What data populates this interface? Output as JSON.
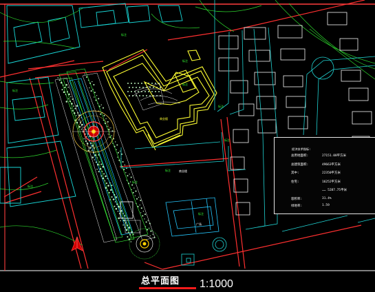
{
  "drawing": {
    "title": "总平面图",
    "scale": "1:1000"
  },
  "info_panel": {
    "heading": "经济技术指标:",
    "rows": [
      {
        "label": "总用地面积:",
        "value": "27151.08平方米"
      },
      {
        "label": "总建筑面积:",
        "value": "49663平方米"
      },
      {
        "label": "其中:",
        "value": "22350平方米"
      },
      {
        "label": "住宅:",
        "value": "16252平方米"
      },
      {
        "label": "",
        "value": "…… 5287.75平米"
      },
      {
        "label": "容积率:",
        "value": "31.4%"
      },
      {
        "label": "绿地率:",
        "value": "1.59"
      }
    ]
  },
  "labels": {
    "green_notes": [
      "标注",
      "标注",
      "标注",
      "标注",
      "标注",
      "标注",
      "标注",
      "标注",
      "标注",
      "标注"
    ],
    "building_label": "商业楼",
    "block_label": "商业楼",
    "plaza_label": "广场"
  },
  "colors": {
    "road_red": "#ff2a2a",
    "green": "#22e022",
    "yellow": "#ffff33",
    "cyan": "#18e6e6",
    "white": "#f2f2f2"
  }
}
